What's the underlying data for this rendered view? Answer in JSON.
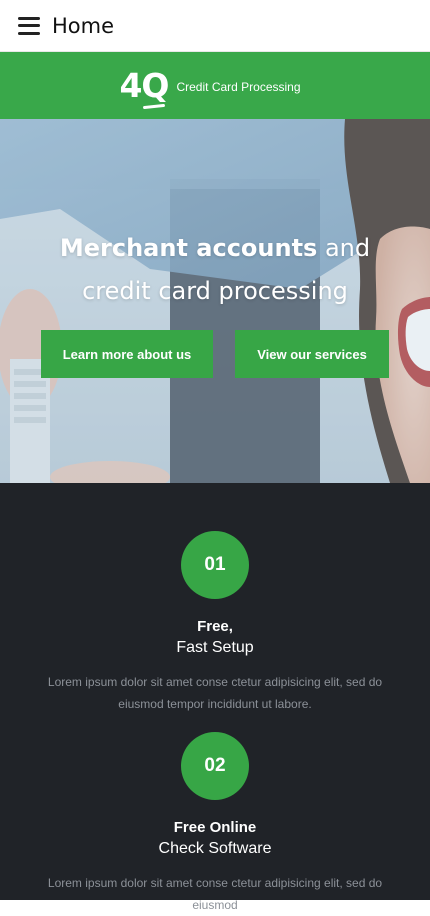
{
  "header": {
    "title": "Home",
    "menu_icon": "hamburger-menu-icon"
  },
  "brand": {
    "logo_text": "4Q",
    "tagline": "Credit Card Processing",
    "color": "#39a84a"
  },
  "hero": {
    "heading_bold": "Merchant accounts",
    "heading_rest": " and credit card processing",
    "buttons": [
      {
        "label": "Learn more about us"
      },
      {
        "label": "View our services"
      }
    ]
  },
  "features": [
    {
      "number": "01",
      "title": "Free,",
      "subtitle": "Fast Setup",
      "text": "Lorem ipsum dolor sit amet conse ctetur adipisicing elit, sed do eiusmod tempor incididunt ut labore."
    },
    {
      "number": "02",
      "title": "Free Online",
      "subtitle": "Check Software",
      "text": "Lorem ipsum dolor sit amet conse ctetur adipisicing elit, sed do eiusmod"
    }
  ],
  "colors": {
    "accent": "#37a646",
    "dark_section": "#202328",
    "muted_text": "#8c9198"
  }
}
